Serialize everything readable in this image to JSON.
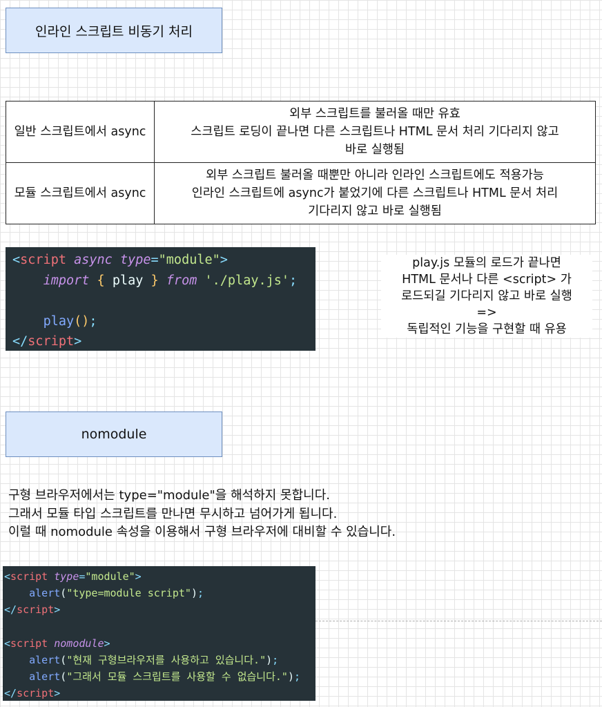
{
  "section1": {
    "title": "인라인 스크립트 비동기 처리"
  },
  "table": {
    "rows": [
      {
        "header": "일반 스크립트에서 async",
        "lines": [
          "외부 스크립트를 불러올 때만 유효",
          "스크립트 로딩이 끝나면 다른 스크립트나 HTML 문서 처리 기다리지 않고",
          "바로 실행됨"
        ]
      },
      {
        "header": "모듈 스크립트에서 async",
        "lines": [
          "외부 스크립트 불러올 때뿐만 아니라 인라인 스크립트에도 적용가능",
          "인라인 스크립트에 async가 붙었기에 다른 스크립트나 HTML 문서 처리",
          "기다리지 않고 바로 실행됨"
        ]
      }
    ]
  },
  "code1": {
    "l1_open": "<",
    "l1_tag": "script",
    "l1_async": "async",
    "l1_type": "type",
    "l1_eq": "=",
    "l1_val": "\"module\"",
    "l1_close": ">",
    "l2_import": "import",
    "l2_lbrace": "{",
    "l2_name": "play",
    "l2_rbrace": "}",
    "l2_from": "from",
    "l2_path": "'./play.js'",
    "l2_semi": ";",
    "l4_fn": "play",
    "l4_parens": "()",
    "l4_semi": ";",
    "l5_open": "</",
    "l5_tag": "script",
    "l5_close": ">"
  },
  "note": {
    "lines": [
      "play.js 모듈의 로드가 끝나면",
      "HTML 문서나 다른 <script> 가",
      "로드되길 기다리지 않고 바로 실행",
      "=>",
      "독립적인 기능을 구현할 때 유용"
    ]
  },
  "section2": {
    "title": "nomodule"
  },
  "paragraph": {
    "lines": [
      "구형 브라우저에서는 type=\"module\"을 해석하지 못합니다.",
      "그래서 모듈 타입 스크립트를 만나면 무시하고 넘어가게 됩니다.",
      "이럴 때 nomodule 속성을 이용해서 구형 브라우저에 대비할 수 있습니다."
    ]
  },
  "code2": {
    "l1_open": "<",
    "l1_tag": "script",
    "l1_type": "type",
    "l1_eq": "=",
    "l1_val": "\"module\"",
    "l1_close": ">",
    "l2_fn": "alert",
    "l2_lp": "(",
    "l2_str": "\"type=module script\"",
    "l2_rp": ")",
    "l2_semi": ";",
    "l3_open": "</",
    "l3_tag": "script",
    "l3_close": ">",
    "l5_open": "<",
    "l5_tag": "script",
    "l5_attr": "nomodule",
    "l5_close": ">",
    "l6_fn": "alert",
    "l6_lp": "(",
    "l6_str": "\"현재 구형브라우저를 사용하고 있습니다.\"",
    "l6_rp": ")",
    "l6_semi": ";",
    "l7_fn": "alert",
    "l7_lp": "(",
    "l7_str": "\"그래서 모듈 스크립트를 사용할 수 없습니다.\"",
    "l7_rp": ")",
    "l7_semi": ";",
    "l8_open": "</",
    "l8_tag": "script",
    "l8_close": ">"
  }
}
